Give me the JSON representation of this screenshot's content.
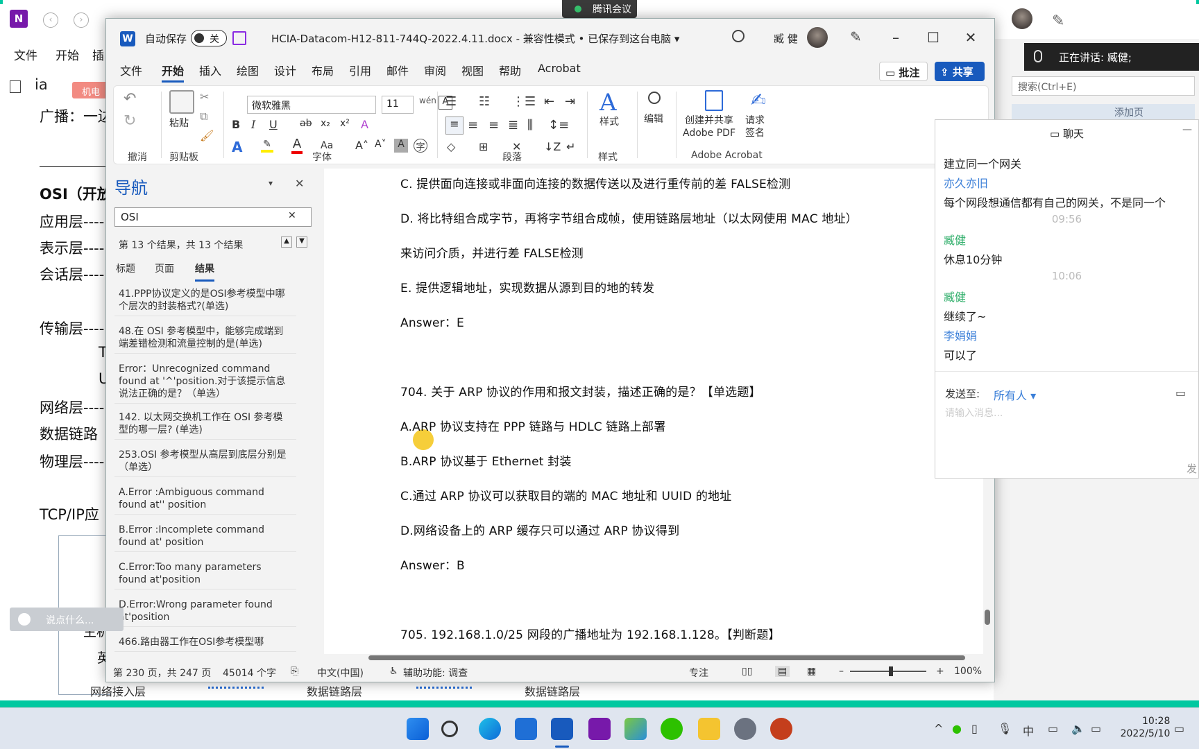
{
  "onenote": {
    "menu": [
      "文件",
      "开始",
      "插"
    ],
    "notebook_initial": "ia",
    "tag": "机电",
    "search_placeholder": "搜索(Ctrl+E)",
    "add_page": "添加页",
    "left_lines": [
      "广播：一边",
      "OSI（开放",
      "应用层----",
      "表示层----",
      "会话层----",
      "传输层----",
      "T",
      "U",
      "网络层----",
      "数据链路",
      "物理层----",
      "TCP/IP应",
      "主机",
      "英"
    ],
    "bottom_labels": [
      "网络接入层",
      "数据链路层",
      "数据链路层"
    ]
  },
  "meeting": {
    "app_name": "腾讯会议",
    "speaking": "正在讲话: 臧健;"
  },
  "word": {
    "autosave_label": "自动保存",
    "autosave_state": "关",
    "doc_title": "HCIA-Datacom-H12-811-744Q-2022.4.11.docx  -  兼容性模式 • 已保存到这台电脑 ▾",
    "user": "臧 健",
    "tabs": [
      "文件",
      "开始",
      "插入",
      "绘图",
      "设计",
      "布局",
      "引用",
      "邮件",
      "审阅",
      "视图",
      "帮助",
      "Acrobat"
    ],
    "comment_btn": "批注",
    "share_btn": "共享",
    "ribbon": {
      "undo_group": "撤消",
      "clipboard_group": "剪贴板",
      "paste": "粘贴",
      "font_group": "字体",
      "font_name": "微软雅黑",
      "font_size": "11",
      "paragraph_group": "段落",
      "styles_group": "样式",
      "styles": "样式",
      "edit": "编辑",
      "create_pdf": "创建并共享\nAdobe PDF",
      "request_sign": "请求\n签名",
      "acrobat_group": "Adobe Acrobat"
    },
    "nav": {
      "title": "导航",
      "search_value": "OSI",
      "count": "第 13 个结果，共 13 个结果",
      "tabs": [
        "标题",
        "页面",
        "结果"
      ],
      "results": [
        "41.PPP协议定义的是OSI参考模型中哪个层次的封装格式?(单选)",
        "48.在 OSI 参考模型中，能够完成端到端差错检测和流量控制的是(单选)",
        "Error：Unrecognized command found at '^'position.对于该提示信息说法正确的是？（单选）",
        "142. 以太网交换机工作在 OSI 参考模型的哪一层? (单选)",
        "253.OSI 参考模型从高层到底层分别是（单选）",
        "A.Error :Ambiguous command found at'' position",
        "B.Error :Incomplete command found at' position",
        "C.Error:Too many parameters found at'position",
        "D.Error:Wrong parameter found at'position",
        "466.路由器工作在OSI参考模型哪"
      ]
    },
    "doc_lines": [
      "C. 提供面向连接或非面向连接的数据传送以及进行重传前的差 FALSE检测",
      "D. 将比特组合成字节，再将字节组合成帧，使用链路层地址（以太网使用 MAC 地址）",
      "来访问介质，并进行差 FALSE检测",
      "E. 提供逻辑地址，实现数据从源到目的地的转发",
      "Answer：E",
      "704. 关于 ARP 协议的作用和报文封装，描述正确的是？【单选题】",
      "A.ARP 协议支持在 PPP 链路与 HDLC 链路上部署",
      "B.ARP 协议基于 Ethernet 封装",
      "C.通过 ARP 协议可以获取目的端的 MAC 地址和 UUID 的地址",
      "D.网络设备上的 ARP 缓存只可以通过 ARP 协议得到",
      "Answer：B",
      "705. 192.168.1.0/25 网段的广播地址为 192.168.1.128。【判断题】"
    ],
    "status": {
      "page": "第 230 页，共 247 页",
      "words": "45014 个字",
      "lang": "中文(中国)",
      "accessibility": "辅助功能: 调查",
      "focus": "专注",
      "zoom": "100%"
    }
  },
  "chat": {
    "title": "聊天",
    "messages": [
      {
        "type": "text",
        "text": "建立同一个网关"
      },
      {
        "type": "name",
        "text": "亦久亦旧",
        "color": "blue"
      },
      {
        "type": "text",
        "text": "每个网段想通信都有自己的网关，不是同一个"
      },
      {
        "type": "time",
        "text": "09:56"
      },
      {
        "type": "name",
        "text": "臧健",
        "color": "green"
      },
      {
        "type": "text",
        "text": "休息10分钟"
      },
      {
        "type": "time",
        "text": "10:06"
      },
      {
        "type": "name",
        "text": "臧健",
        "color": "green"
      },
      {
        "type": "text",
        "text": "继续了~"
      },
      {
        "type": "name",
        "text": "李娟娟",
        "color": "blue"
      },
      {
        "type": "text",
        "text": "可以了"
      }
    ],
    "send_to_label": "发送至:",
    "send_to_value": "所有人 ▾",
    "input_placeholder": "请输入消息...",
    "send": "发"
  },
  "speak_bubble": "说点什么...",
  "taskbar": {
    "time": "10:28",
    "date": "2022/5/10",
    "ime": "中"
  }
}
